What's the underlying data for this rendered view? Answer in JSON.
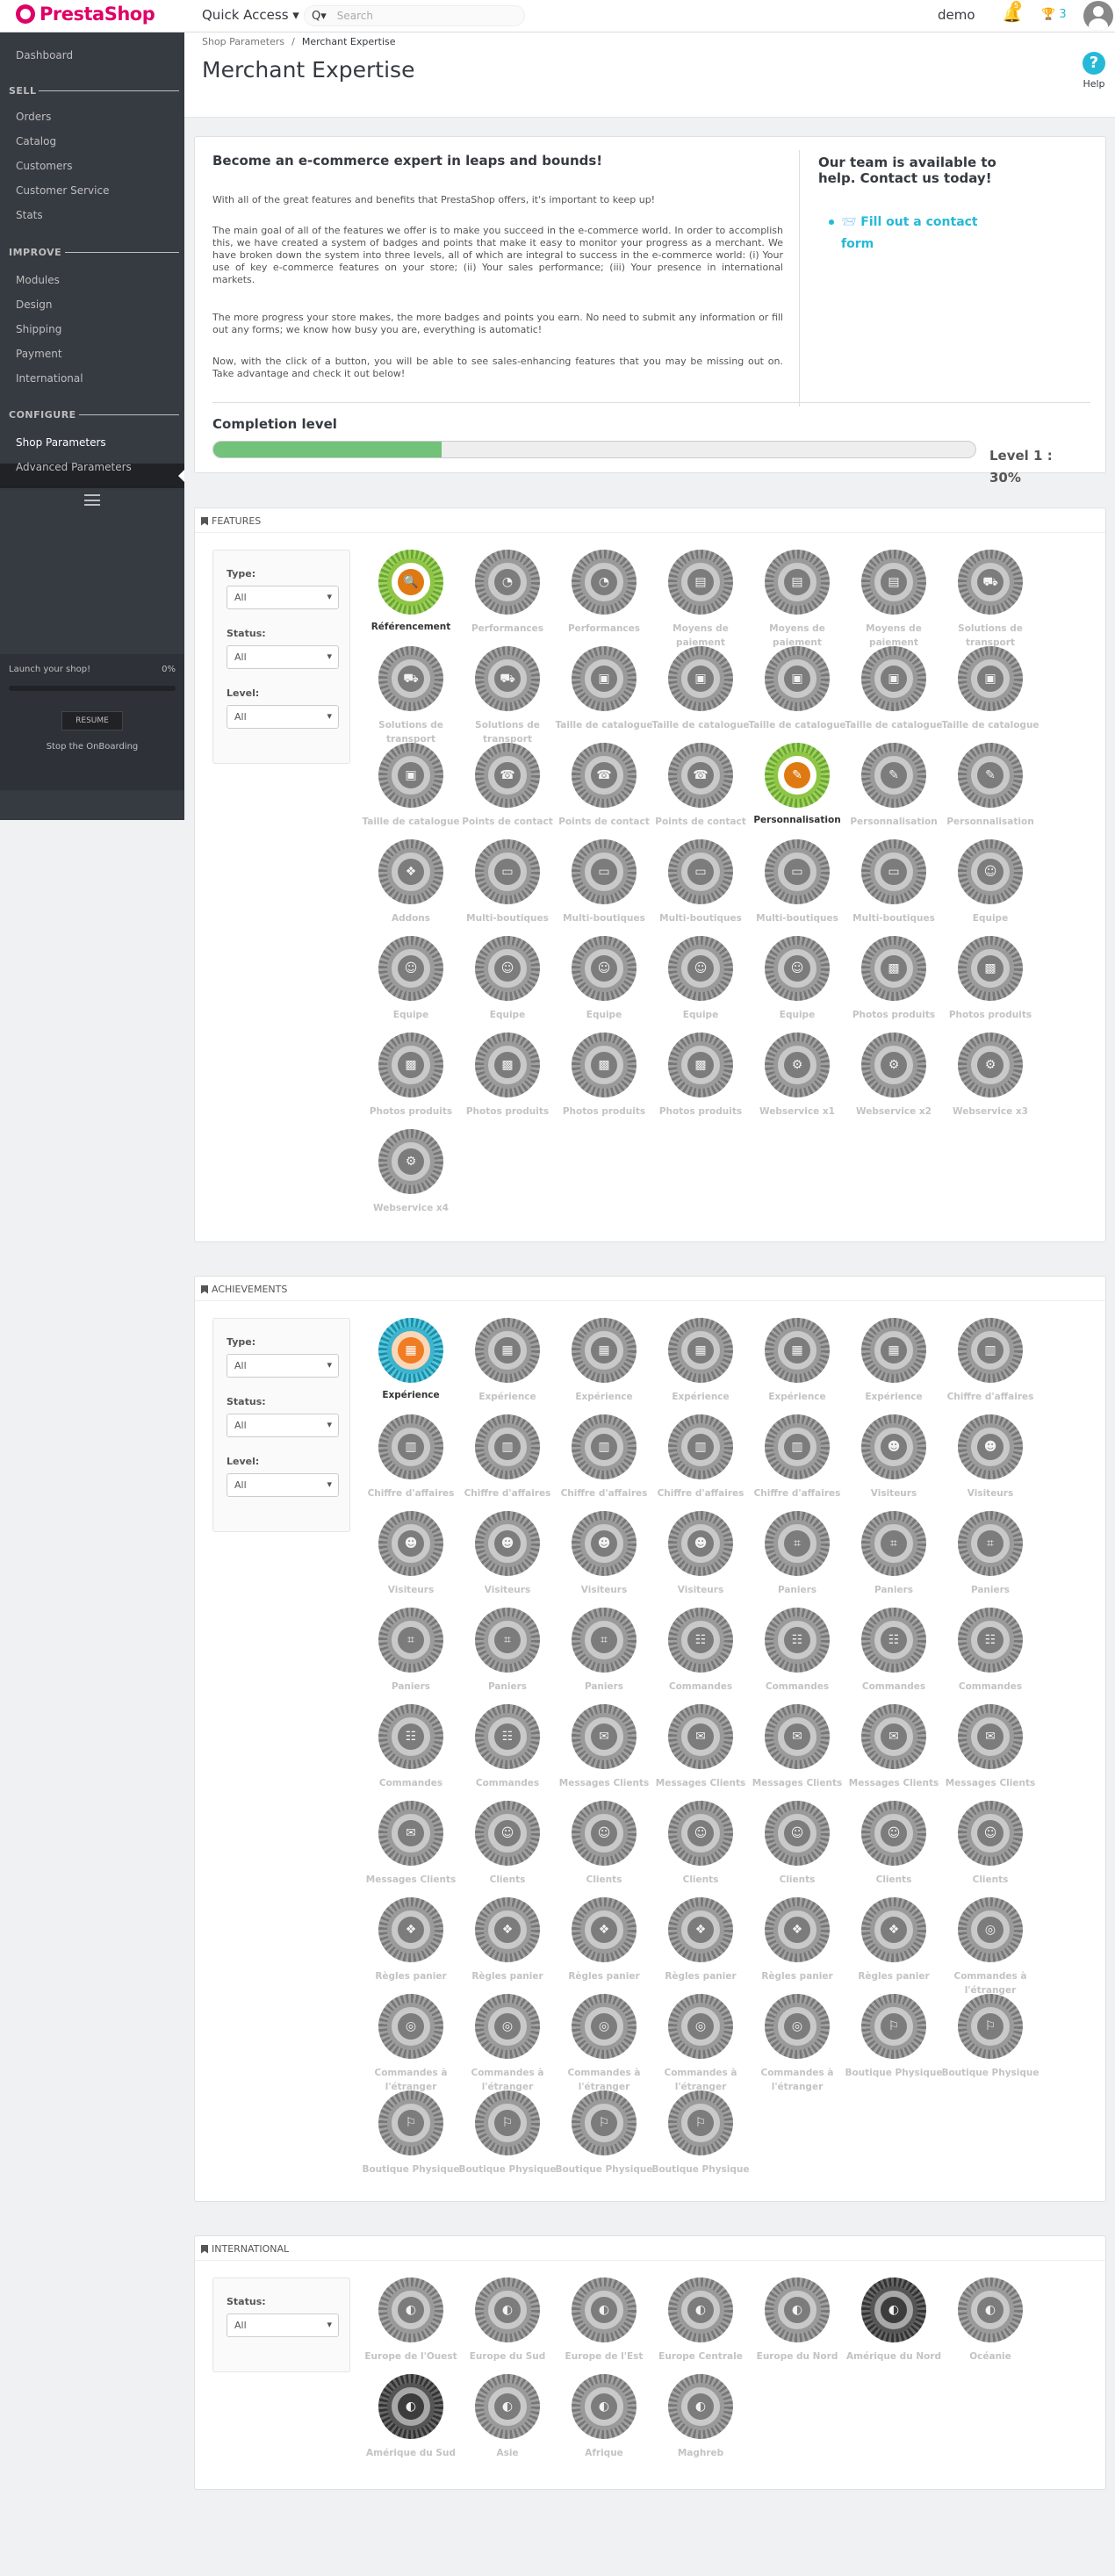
{
  "header": {
    "brand": "PrestaShop",
    "quick_access": "Quick Access ▾",
    "search_icon": "Q▾",
    "search_placeholder": "Search",
    "user": "demo",
    "notif_count": "5",
    "trophy_label": "🏆 3"
  },
  "sidebar": {
    "dashboard": "Dashboard",
    "sell": "SELL",
    "orders": "Orders",
    "catalog": "Catalog",
    "customers": "Customers",
    "customer_service": "Customer Service",
    "stats": "Stats",
    "improve": "IMPROVE",
    "modules": "Modules",
    "design": "Design",
    "shipping": "Shipping",
    "payment": "Payment",
    "international": "International",
    "configure": "CONFIGURE",
    "shop_parameters": "Shop Parameters",
    "advanced_parameters": "Advanced Parameters"
  },
  "onboarding": {
    "title": "Launch your shop!",
    "percent": "0%",
    "progress": 0,
    "resume": "RESUME",
    "stop": "Stop the OnBoarding"
  },
  "breadcrumb": {
    "parent": "Shop Parameters",
    "sep": "/",
    "current": "Merchant Expertise"
  },
  "page_title": "Merchant Expertise",
  "help_label": "Help",
  "intro": {
    "title": "Become an e-commerce expert in leaps and bounds!",
    "p1": "With all of the great features and benefits that PrestaShop offers, it's important to keep up!",
    "p2": "The main goal of all of the features we offer is to make you succeed in the e-commerce world. In order to accomplish this, we have created a system of badges and points that make it easy to monitor your progress as a merchant. We have broken down the system into three levels, all of which are integral to success in the e-commerce world: (i) Your use of key e-commerce features on your store; (ii) Your sales performance; (iii) Your presence in international markets.",
    "p3": "The more progress your store makes, the more badges and points you earn. No need to submit any information or fill out any forms; we know how busy you are, everything is automatic!",
    "p4": "Now, with the click of a button, you will be able to see sales-enhancing features that you may be missing out on. Take advantage and check it out below!",
    "team_title": "Our team is available to help. Contact us today!",
    "contact_link": "📨 Fill out a contact form",
    "completion_title": "Completion level",
    "completion_progress": 0.3,
    "completion_level": "Level 1 : 30%"
  },
  "filters": {
    "type": "Type:",
    "status": "Status:",
    "level": "Level:",
    "all": "All"
  },
  "features": {
    "title": "FEATURES",
    "badges": [
      {
        "label": "Référencement",
        "icon": "🔍",
        "on": true
      },
      {
        "label": "Performances",
        "icon": "◔"
      },
      {
        "label": "Performances",
        "icon": "◔"
      },
      {
        "label": "Moyens de paiement",
        "icon": "▤"
      },
      {
        "label": "Moyens de paiement",
        "icon": "▤"
      },
      {
        "label": "Moyens de paiement",
        "icon": "▤"
      },
      {
        "label": "Solutions de transport",
        "icon": "⛟"
      },
      {
        "label": "Solutions de transport",
        "icon": "⛟"
      },
      {
        "label": "Solutions de transport",
        "icon": "⛟"
      },
      {
        "label": "Taille de catalogue",
        "icon": "▣"
      },
      {
        "label": "Taille de catalogue",
        "icon": "▣"
      },
      {
        "label": "Taille de catalogue",
        "icon": "▣"
      },
      {
        "label": "Taille de catalogue",
        "icon": "▣"
      },
      {
        "label": "Taille de catalogue",
        "icon": "▣"
      },
      {
        "label": "Taille de catalogue",
        "icon": "▣"
      },
      {
        "label": "Points de contact",
        "icon": "☎"
      },
      {
        "label": "Points de contact",
        "icon": "☎"
      },
      {
        "label": "Points de contact",
        "icon": "☎"
      },
      {
        "label": "Personnalisation",
        "icon": "✎",
        "on": true
      },
      {
        "label": "Personnalisation",
        "icon": "✎"
      },
      {
        "label": "Personnalisation",
        "icon": "✎"
      },
      {
        "label": "Addons",
        "icon": "❖"
      },
      {
        "label": "Multi-boutiques",
        "icon": "▭"
      },
      {
        "label": "Multi-boutiques",
        "icon": "▭"
      },
      {
        "label": "Multi-boutiques",
        "icon": "▭"
      },
      {
        "label": "Multi-boutiques",
        "icon": "▭"
      },
      {
        "label": "Multi-boutiques",
        "icon": "▭"
      },
      {
        "label": "Equipe",
        "icon": "☺"
      },
      {
        "label": "Equipe",
        "icon": "☺"
      },
      {
        "label": "Equipe",
        "icon": "☺"
      },
      {
        "label": "Equipe",
        "icon": "☺"
      },
      {
        "label": "Equipe",
        "icon": "☺"
      },
      {
        "label": "Equipe",
        "icon": "☺"
      },
      {
        "label": "Photos produits",
        "icon": "▩"
      },
      {
        "label": "Photos produits",
        "icon": "▩"
      },
      {
        "label": "Photos produits",
        "icon": "▩"
      },
      {
        "label": "Photos produits",
        "icon": "▩"
      },
      {
        "label": "Photos produits",
        "icon": "▩"
      },
      {
        "label": "Photos produits",
        "icon": "▩"
      },
      {
        "label": "Webservice x1",
        "icon": "⚙"
      },
      {
        "label": "Webservice x2",
        "icon": "⚙"
      },
      {
        "label": "Webservice x3",
        "icon": "⚙"
      },
      {
        "label": "Webservice x4",
        "icon": "⚙"
      }
    ]
  },
  "achievements": {
    "title": "ACHIEVEMENTS",
    "badges": [
      {
        "label": "Expérience",
        "icon": "▦",
        "on": true
      },
      {
        "label": "Expérience",
        "icon": "▦"
      },
      {
        "label": "Expérience",
        "icon": "▦"
      },
      {
        "label": "Expérience",
        "icon": "▦"
      },
      {
        "label": "Expérience",
        "icon": "▦"
      },
      {
        "label": "Expérience",
        "icon": "▦"
      },
      {
        "label": "Chiffre d'affaires",
        "icon": "▥"
      },
      {
        "label": "Chiffre d'affaires",
        "icon": "▥"
      },
      {
        "label": "Chiffre d'affaires",
        "icon": "▥"
      },
      {
        "label": "Chiffre d'affaires",
        "icon": "▥"
      },
      {
        "label": "Chiffre d'affaires",
        "icon": "▥"
      },
      {
        "label": "Chiffre d'affaires",
        "icon": "▥"
      },
      {
        "label": "Visiteurs",
        "icon": "☻"
      },
      {
        "label": "Visiteurs",
        "icon": "☻"
      },
      {
        "label": "Visiteurs",
        "icon": "☻"
      },
      {
        "label": "Visiteurs",
        "icon": "☻"
      },
      {
        "label": "Visiteurs",
        "icon": "☻"
      },
      {
        "label": "Visiteurs",
        "icon": "☻"
      },
      {
        "label": "Paniers",
        "icon": "⌗"
      },
      {
        "label": "Paniers",
        "icon": "⌗"
      },
      {
        "label": "Paniers",
        "icon": "⌗"
      },
      {
        "label": "Paniers",
        "icon": "⌗"
      },
      {
        "label": "Paniers",
        "icon": "⌗"
      },
      {
        "label": "Paniers",
        "icon": "⌗"
      },
      {
        "label": "Commandes",
        "icon": "☷"
      },
      {
        "label": "Commandes",
        "icon": "☷"
      },
      {
        "label": "Commandes",
        "icon": "☷"
      },
      {
        "label": "Commandes",
        "icon": "☷"
      },
      {
        "label": "Commandes",
        "icon": "☷"
      },
      {
        "label": "Commandes",
        "icon": "☷"
      },
      {
        "label": "Messages Clients",
        "icon": "✉"
      },
      {
        "label": "Messages Clients",
        "icon": "✉"
      },
      {
        "label": "Messages Clients",
        "icon": "✉"
      },
      {
        "label": "Messages Clients",
        "icon": "✉"
      },
      {
        "label": "Messages Clients",
        "icon": "✉"
      },
      {
        "label": "Messages Clients",
        "icon": "✉"
      },
      {
        "label": "Clients",
        "icon": "☺"
      },
      {
        "label": "Clients",
        "icon": "☺"
      },
      {
        "label": "Clients",
        "icon": "☺"
      },
      {
        "label": "Clients",
        "icon": "☺"
      },
      {
        "label": "Clients",
        "icon": "☺"
      },
      {
        "label": "Clients",
        "icon": "☺"
      },
      {
        "label": "Règles panier",
        "icon": "❖"
      },
      {
        "label": "Règles panier",
        "icon": "❖"
      },
      {
        "label": "Règles panier",
        "icon": "❖"
      },
      {
        "label": "Règles panier",
        "icon": "❖"
      },
      {
        "label": "Règles panier",
        "icon": "❖"
      },
      {
        "label": "Règles panier",
        "icon": "❖"
      },
      {
        "label": "Commandes à l'étranger",
        "icon": "◎"
      },
      {
        "label": "Commandes à l'étranger",
        "icon": "◎"
      },
      {
        "label": "Commandes à l'étranger",
        "icon": "◎"
      },
      {
        "label": "Commandes à l'étranger",
        "icon": "◎"
      },
      {
        "label": "Commandes à l'étranger",
        "icon": "◎"
      },
      {
        "label": "Commandes à l'étranger",
        "icon": "◎"
      },
      {
        "label": "Boutique Physique",
        "icon": "⚐"
      },
      {
        "label": "Boutique Physique",
        "icon": "⚐"
      },
      {
        "label": "Boutique Physique",
        "icon": "⚐"
      },
      {
        "label": "Boutique Physique",
        "icon": "⚐"
      },
      {
        "label": "Boutique Physique",
        "icon": "⚐"
      },
      {
        "label": "Boutique Physique",
        "icon": "⚐"
      }
    ]
  },
  "international": {
    "title": "INTERNATIONAL",
    "badges": [
      {
        "label": "Europe de l'Ouest",
        "icon": "◐"
      },
      {
        "label": "Europe du Sud",
        "icon": "◐"
      },
      {
        "label": "Europe de l'Est",
        "icon": "◐"
      },
      {
        "label": "Europe Centrale",
        "icon": "◐"
      },
      {
        "label": "Europe du Nord",
        "icon": "◐"
      },
      {
        "label": "Amérique du Nord",
        "icon": "◐",
        "dark": true
      },
      {
        "label": "Océanie",
        "icon": "◐"
      },
      {
        "label": "Amérique du Sud",
        "icon": "◐",
        "dark": true
      },
      {
        "label": "Asie",
        "icon": "◐"
      },
      {
        "label": "Afrique",
        "icon": "◐"
      },
      {
        "label": "Maghreb",
        "icon": "◐"
      }
    ]
  },
  "colors": {
    "accent": "#25b9d7",
    "brand": "#df0067",
    "sidebar_bg": "#363a41",
    "progress_green": "#72c279"
  }
}
